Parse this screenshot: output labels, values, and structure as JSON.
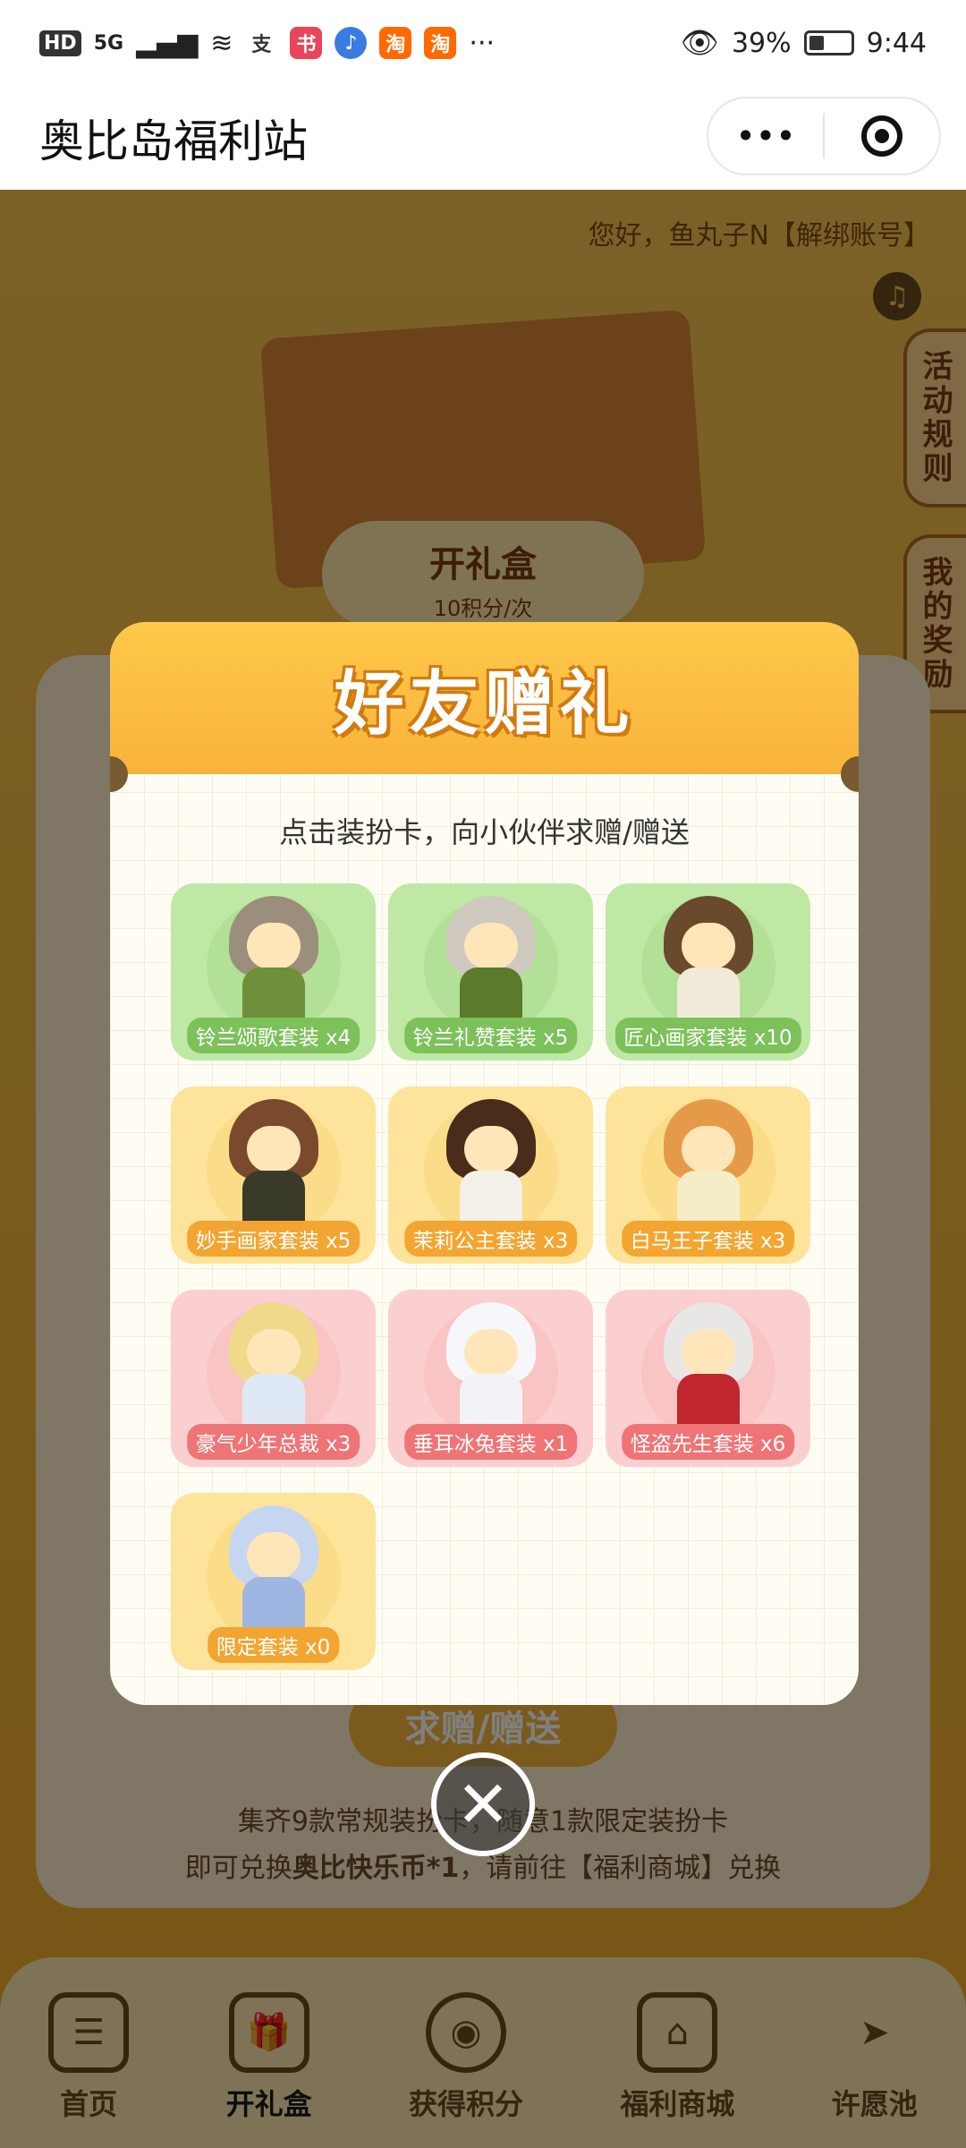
{
  "statusbar": {
    "left_badge": "HD",
    "network": "5G",
    "apps": [
      "支",
      "书",
      "♪",
      "淘",
      "淘"
    ],
    "more": "···",
    "battery": "39%",
    "time": "9:44"
  },
  "titlebar": {
    "title": "奥比岛福利站",
    "more_label": "•••"
  },
  "background": {
    "greeting": "您好，鱼丸子N【解绑账号】",
    "music_icon": "♫",
    "side_tabs": [
      "活动规则",
      "我的奖励"
    ],
    "open_box_label": "开礼盒",
    "open_box_cost": "10积分/次",
    "ask_button": "求赠/赠送",
    "info_line1": "集齐9款常规装扮卡，随意1款限定装扮卡",
    "info_line2_pre": "即可兑换",
    "info_line2_bold": "奥比快乐币*1",
    "info_line2_post": "，请前往【福利商城】兑换"
  },
  "tabbar": {
    "items": [
      {
        "label": "首页",
        "icon": "calendar-icon",
        "glyph": "☰"
      },
      {
        "label": "开礼盒",
        "icon": "gift-box-icon",
        "glyph": "🎁"
      },
      {
        "label": "获得积分",
        "icon": "bear-coin-icon",
        "glyph": "◉"
      },
      {
        "label": "福利商城",
        "icon": "shop-icon",
        "glyph": "⌂"
      },
      {
        "label": "许愿池",
        "icon": "paper-plane-icon",
        "glyph": "➤"
      }
    ],
    "active_index": 1
  },
  "modal": {
    "title": "好友赠礼",
    "subtitle": "点击装扮卡，向小伙伴求赠/赠送",
    "cards": [
      {
        "label": "铃兰颂歌套装 x4",
        "color": "green"
      },
      {
        "label": "铃兰礼赞套装 x5",
        "color": "green"
      },
      {
        "label": "匠心画家套装 x10",
        "color": "green"
      },
      {
        "label": "妙手画家套装 x5",
        "color": "yellow"
      },
      {
        "label": "茉莉公主套装 x3",
        "color": "yellow"
      },
      {
        "label": "白马王子套装 x3",
        "color": "yellow"
      },
      {
        "label": "豪气少年总裁 x3",
        "color": "pink"
      },
      {
        "label": "垂耳冰兔套装 x1",
        "color": "pink"
      },
      {
        "label": "怪盗先生套装 x6",
        "color": "pink"
      },
      {
        "label": "限定套装 x0",
        "color": "yellow"
      }
    ],
    "close_glyph": "✕"
  },
  "colors": {
    "accent_orange": "#f7b23a",
    "green_card": "#bfe8a4",
    "yellow_card": "#fde49a",
    "pink_card": "#fbcfcf"
  }
}
